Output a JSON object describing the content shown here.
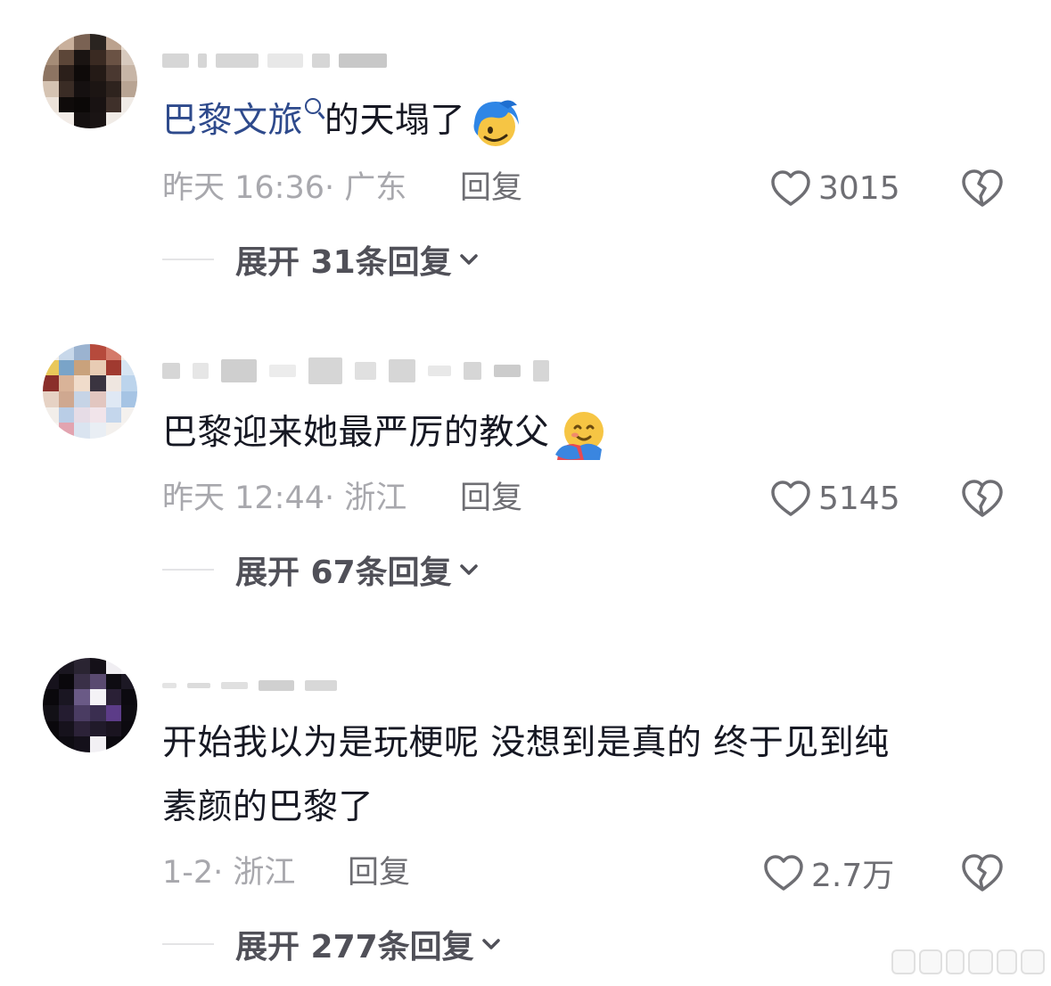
{
  "comments": [
    {
      "link_text": "巴黎文旅",
      "text": "的天塌了",
      "emoji": "blue-hair-smiling-face-emoji",
      "time": "昨天 16:36",
      "location": "· 广东",
      "reply_label": "回复",
      "likes": "3015",
      "expand_label": "展开 31条回复"
    },
    {
      "text": "巴黎迎来她最严厉的教父",
      "emoji": "hugging-face-emoji",
      "time": "昨天 12:44",
      "location": "· 浙江",
      "reply_label": "回复",
      "likes": "5145",
      "expand_label": "展开 67条回复"
    },
    {
      "text_line1": "开始我以为是玩梗呢  没想到是真的  终于见到纯",
      "text_line2": "素颜的巴黎了",
      "time": "1-2",
      "location": "· 浙江",
      "reply_label": "回复",
      "likes": "2.7万",
      "expand_label": "展开 277条回复"
    }
  ],
  "colors": {
    "link": "#2e4a8c",
    "meta": "#a8a8ad",
    "action": "#6e6e73",
    "text": "#161823"
  },
  "icons": [
    "heart-outline-icon",
    "broken-heart-icon",
    "chevron-down-icon",
    "search-icon"
  ]
}
